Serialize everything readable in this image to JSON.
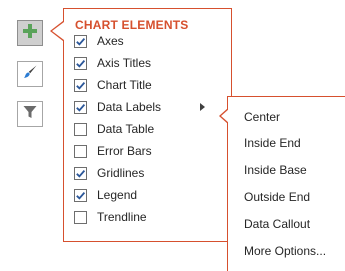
{
  "side_buttons": [
    {
      "icon": "plus-icon",
      "active": true
    },
    {
      "icon": "paintbrush-icon",
      "active": false
    },
    {
      "icon": "filter-icon",
      "active": false
    }
  ],
  "chart_elements": {
    "title": "CHART ELEMENTS",
    "items": [
      {
        "label": "Axes",
        "checked": true
      },
      {
        "label": "Axis Titles",
        "checked": true
      },
      {
        "label": "Chart Title",
        "checked": true
      },
      {
        "label": "Data Labels",
        "checked": true,
        "has_submenu": true
      },
      {
        "label": "Data Table",
        "checked": false
      },
      {
        "label": "Error Bars",
        "checked": false
      },
      {
        "label": "Gridlines",
        "checked": true
      },
      {
        "label": "Legend",
        "checked": true
      },
      {
        "label": "Trendline",
        "checked": false
      }
    ]
  },
  "data_labels_submenu": {
    "items": [
      "Center",
      "Inside End",
      "Inside Base",
      "Outside End",
      "Data Callout",
      "More Options..."
    ]
  },
  "colors": {
    "accent": "#d6502e",
    "plus": "#5aa35a",
    "check": "#2b579a"
  }
}
